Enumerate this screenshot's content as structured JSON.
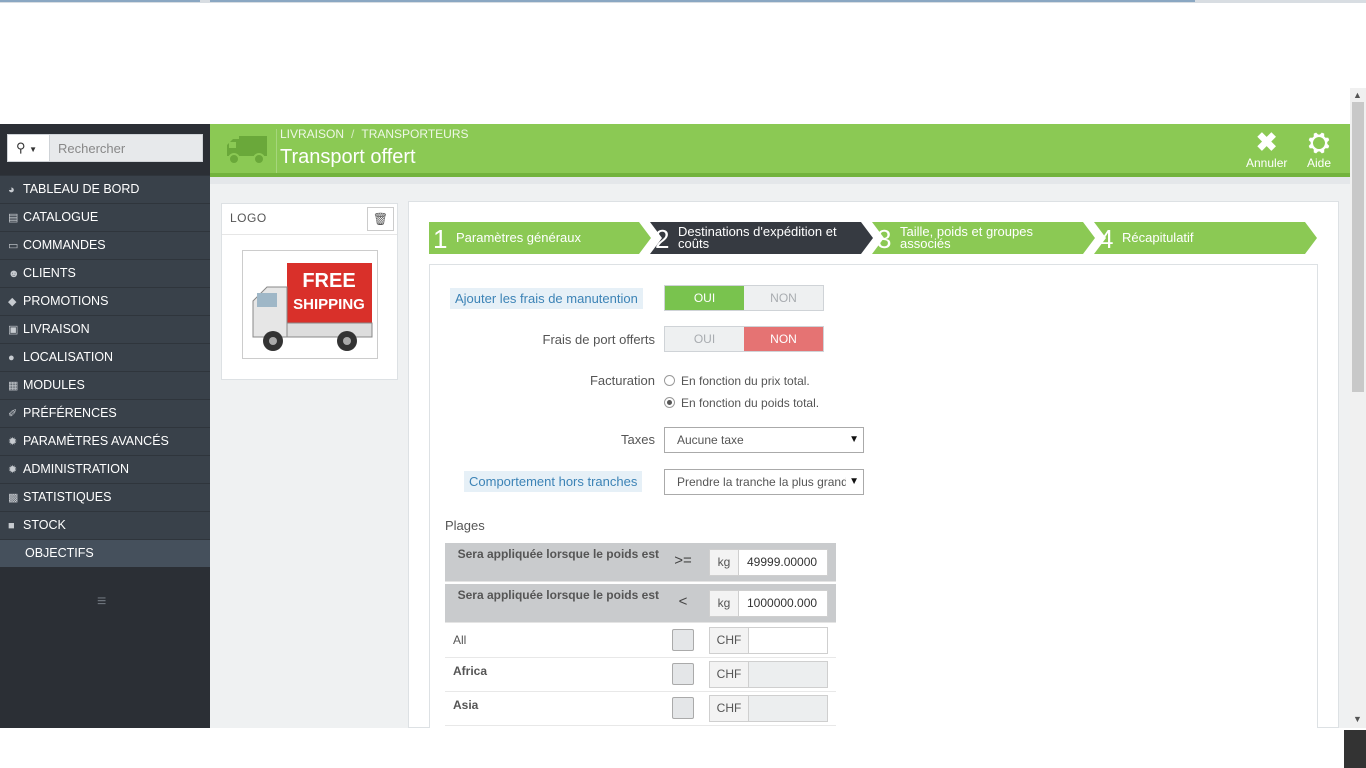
{
  "colors": {
    "header_green": "#8bc954",
    "sidebar_dark": "#2b2f35",
    "step_active": "#363a41",
    "step_green": "#8bc954",
    "toggle_green": "#79c34e",
    "toggle_red": "#e57373"
  },
  "search": {
    "placeholder": "Rechercher",
    "icon": "search-icon"
  },
  "sidebar": {
    "items": [
      {
        "label": "TABLEAU DE BORD",
        "icon": "dashboard-icon"
      },
      {
        "label": "CATALOGUE",
        "icon": "book-icon"
      },
      {
        "label": "COMMANDES",
        "icon": "credit-card-icon"
      },
      {
        "label": "CLIENTS",
        "icon": "users-icon"
      },
      {
        "label": "PROMOTIONS",
        "icon": "tag-icon"
      },
      {
        "label": "LIVRAISON",
        "icon": "truck-icon"
      },
      {
        "label": "LOCALISATION",
        "icon": "globe-icon"
      },
      {
        "label": "MODULES",
        "icon": "puzzle-icon"
      },
      {
        "label": "PRÉFÉRENCES",
        "icon": "wrench-icon"
      },
      {
        "label": "PARAMÈTRES AVANCÉS",
        "icon": "cogs-icon"
      },
      {
        "label": "ADMINISTRATION",
        "icon": "gear-icon"
      },
      {
        "label": "STATISTIQUES",
        "icon": "bar-chart-icon"
      },
      {
        "label": "STOCK",
        "icon": "archive-icon"
      }
    ],
    "sub_item": "OBJECTIFS"
  },
  "header": {
    "breadcrumb": [
      "LIVRAISON",
      "TRANSPORTEURS"
    ],
    "breadcrumb_sep": "/",
    "title": "Transport offert",
    "cancel_label": "Annuler",
    "help_label": "Aide"
  },
  "logo_panel": {
    "title": "LOGO",
    "image_text": [
      "FREE",
      "SHIPPING"
    ]
  },
  "steps": [
    {
      "num": "1",
      "label": "Paramètres généraux",
      "active": false
    },
    {
      "num": "2",
      "label": "Destinations d'expédition et coûts",
      "active": true
    },
    {
      "num": "3",
      "label": "Taille, poids et groupes associés",
      "active": false
    },
    {
      "num": "4",
      "label": "Récapitulatif",
      "active": false
    }
  ],
  "form": {
    "handling": {
      "label": "Ajouter les frais de manutention",
      "yes": "OUI",
      "no": "NON",
      "value": "OUI"
    },
    "free_shipping": {
      "label": "Frais de port offerts",
      "yes": "OUI",
      "no": "NON",
      "value": "NON"
    },
    "billing": {
      "label": "Facturation",
      "options": [
        "En fonction du prix total.",
        "En fonction du poids total."
      ],
      "selected": "En fonction du poids total."
    },
    "taxes": {
      "label": "Taxes",
      "value": "Aucune taxe"
    },
    "out_of_range": {
      "label": "Comportement hors tranches",
      "value": "Prendre la tranche la plus grande"
    }
  },
  "ranges": {
    "title": "Plages",
    "rows": [
      {
        "label": "Sera appliquée lorsque le poids est",
        "operator": ">=",
        "unit": "kg",
        "value": "49999.00000"
      },
      {
        "label": "Sera appliquée lorsque le poids est",
        "operator": "<",
        "unit": "kg",
        "value": "1000000.000"
      }
    ],
    "zones": [
      {
        "name": "All",
        "currency": "CHF"
      },
      {
        "name": "Africa",
        "currency": "CHF"
      },
      {
        "name": "Asia",
        "currency": "CHF"
      }
    ]
  }
}
